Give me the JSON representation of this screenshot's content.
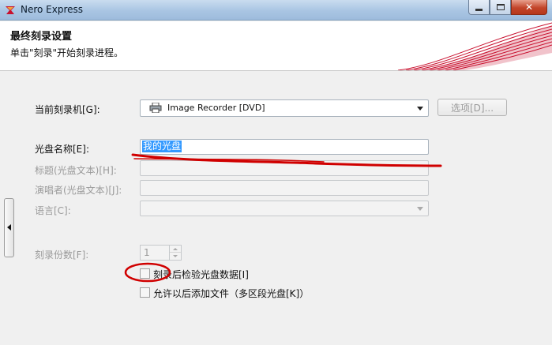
{
  "window": {
    "title": "Nero Express",
    "icon": "nero-flame-icon"
  },
  "header": {
    "title": "最终刻录设置",
    "subtitle": "单击\"刻录\"开始刻录进程。"
  },
  "form": {
    "recorder_label": "当前刻录机[G]:",
    "recorder_value": "Image Recorder   [DVD]",
    "options_button": "选项[D]...",
    "disc_name_label": "光盘名称[E]:",
    "disc_name_value": "我的光盘",
    "title_label": "标题(光盘文本)[H]:",
    "artist_label": "演唱者(光盘文本)[J]:",
    "language_label": "语言[C]:",
    "copies_label": "刻录份数[F]:",
    "copies_value": "1",
    "verify_label": "刻录后检验光盘数据[I]",
    "multisession_label": "允许以后添加文件（多区段光盘[K]）"
  },
  "colors": {
    "accent_selection": "#3399ff",
    "annotation_red": "#d00000",
    "brand_swoosh": "#c8102e"
  }
}
